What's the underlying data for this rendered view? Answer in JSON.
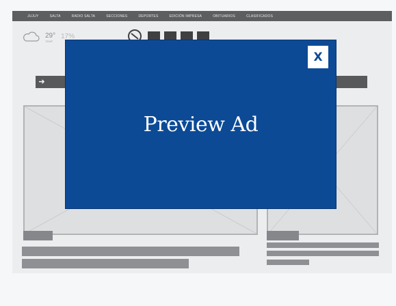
{
  "nav": {
    "items": [
      "JUJUY",
      "SALTA",
      "RADIO SALTA",
      "SECCIONES",
      "DEPORTES",
      "EDICIÓN IMPRESA",
      "OBITUARIOS",
      "CLASIFICADOS"
    ]
  },
  "weather": {
    "icon": "cloud-icon",
    "temp": "29°",
    "temp_label": "TEMP",
    "humidity": "17%"
  },
  "colors": {
    "ad_background": "#0c4a96",
    "nav_background": "#5d5e60",
    "placeholder": "#dedfe1"
  },
  "ad": {
    "title": "Preview Ad",
    "close_label": "X"
  }
}
